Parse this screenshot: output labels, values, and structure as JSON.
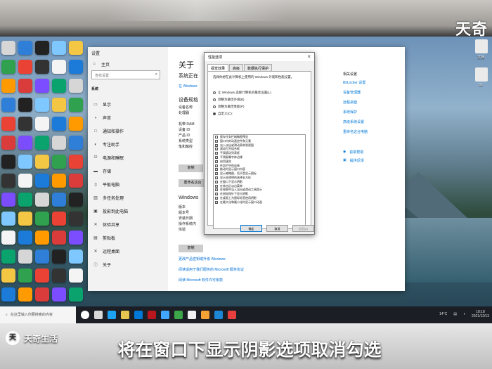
{
  "top": {
    "brand": "天奇"
  },
  "settings": {
    "window_title": "设置",
    "home": "主页",
    "search_placeholder": "查找设置",
    "section": "系统",
    "nav": [
      {
        "icon": "display-icon",
        "label": "显示"
      },
      {
        "icon": "sound-icon",
        "label": "声音"
      },
      {
        "icon": "notification-icon",
        "label": "通知和操作"
      },
      {
        "icon": "focus-icon",
        "label": "专注助手"
      },
      {
        "icon": "power-icon",
        "label": "电源和睡眠"
      },
      {
        "icon": "storage-icon",
        "label": "存储"
      },
      {
        "icon": "tablet-icon",
        "label": "平板电脑"
      },
      {
        "icon": "multitask-icon",
        "label": "多任务处理"
      },
      {
        "icon": "project-icon",
        "label": "投影到此电脑"
      },
      {
        "icon": "share-icon",
        "label": "体验共享"
      },
      {
        "icon": "clipboard-icon",
        "label": "剪贴板"
      },
      {
        "icon": "remote-icon",
        "label": "远程桌面"
      },
      {
        "icon": "about-icon",
        "label": "关于"
      }
    ],
    "content": {
      "title": "关于",
      "line_1": "系统正在",
      "windows_link": "在 Windows",
      "device_spec": "设备规格",
      "spec_rows": [
        "设备名称",
        "处理器",
        "",
        "机带 RAM",
        "设备 ID",
        "产品 ID",
        "系统类型",
        "笔和触控"
      ],
      "copy": "复制",
      "rename": "重命名这台",
      "win_spec": "Windows",
      "win_rows": [
        "版本",
        "版本号",
        "安装日期",
        "操作系统内",
        "体验"
      ],
      "copy2": "复制",
      "link_1": "更改产品密钥或升级 Windows",
      "link_2": "阅读适用于我们服务的 Microsoft 服务协议",
      "link_3": "阅读 Microsoft 软件许可条款"
    },
    "right": {
      "heading": "相关设置",
      "links": [
        "BitLocker 设置",
        "设备管理器",
        "远程桌面",
        "系统保护",
        "高级系统设置",
        "重命名这台电脑"
      ],
      "help": "获取帮助",
      "feedback": "提供反馈"
    }
  },
  "dialog": {
    "title": "性能选项",
    "tabs": [
      "视觉效果",
      "高级",
      "数据执行保护"
    ],
    "description": "选择你想在此计算机上使用的 Windows 外观和性能设置。",
    "radios": [
      {
        "label": "让 Windows 选择计算机的最佳设置(L)",
        "selected": false
      },
      {
        "label": "调整为最佳外观(B)",
        "selected": false
      },
      {
        "label": "调整为最佳性能(P)",
        "selected": false
      },
      {
        "label": "自定义(C):",
        "selected": true
      }
    ],
    "options": [
      {
        "label": "保存任务栏缩略图预览",
        "checked": false
      },
      {
        "label": "窗口内的动画控件和元素",
        "checked": true
      },
      {
        "label": "淡入淡出或滑动菜单到视图",
        "checked": true
      },
      {
        "label": "滚动打开组合框",
        "checked": true
      },
      {
        "label": "平滑滚动列表框",
        "checked": true
      },
      {
        "label": "平滑屏幕字体边缘",
        "checked": true
      },
      {
        "label": "启用速览",
        "checked": true
      },
      {
        "label": "任务栏中的动画",
        "checked": true
      },
      {
        "label": "拖动时显示窗口内容",
        "checked": true
      },
      {
        "label": "显示缩略图，而不是显示图标",
        "checked": true
      },
      {
        "label": "显示亚透明的选择长方形",
        "checked": true
      },
      {
        "label": "在窗口下显示阴影",
        "checked": true
      },
      {
        "label": "在单击后淡出菜单",
        "checked": true
      },
      {
        "label": "在视图中淡入淡出或滑动工具提示",
        "checked": true
      },
      {
        "label": "在鼠标指针下显示阴影",
        "checked": true
      },
      {
        "label": "在桌面上为图标标签使用阴影",
        "checked": true
      },
      {
        "label": "在最大化和最小化时显示窗口动画",
        "checked": true
      }
    ],
    "ok": "确定",
    "cancel": "取消",
    "apply": "应用(A)"
  },
  "taskbar": {
    "search": "在这里输入你要搜索的内容",
    "weather": "14°C",
    "time": "18:18",
    "date": "2021/12/13"
  },
  "watermark": "天奇生活",
  "caption": "将在窗口下显示阴影选项取消勾选"
}
